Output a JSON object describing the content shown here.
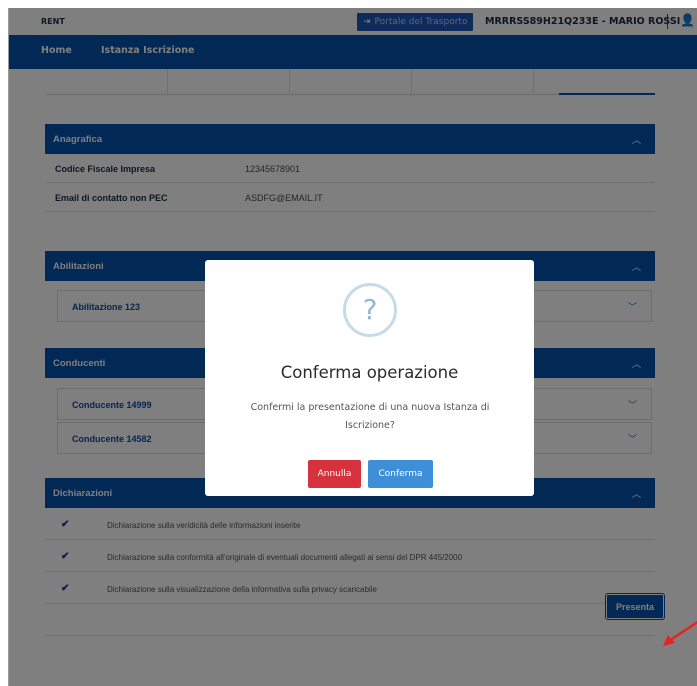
{
  "topbar": {
    "app_name": "RENT",
    "portal_button": "Portale del Trasporto",
    "user_info": "MRRRSS89H21Q233E - MARIO ROSSI"
  },
  "nav": {
    "home": "Home",
    "istanza": "Istanza Iscrizione"
  },
  "anagrafica": {
    "title": "Anagrafica",
    "rows": [
      {
        "label": "Codice Fiscale Impresa",
        "value": "12345678901"
      },
      {
        "label": "Email di contatto non PEC",
        "value": "ASDFG@EMAIL.IT"
      }
    ]
  },
  "abilitazioni": {
    "title": "Abilitazioni",
    "items": [
      "Abilitazione 123"
    ]
  },
  "conducenti": {
    "title": "Conducenti",
    "items": [
      "Conducente 14999",
      "Conducente 14582"
    ]
  },
  "dichiarazioni": {
    "title": "Dichiarazioni",
    "items": [
      "Dichiarazione sulla veridicità delle informazioni inserite",
      "Dichiarazione sulla conformità all'originale di eventuali documenti allegati ai sensi del DPR 445/2000",
      "Dichiarazione sulla visualizzazione della informativa sulla privacy scaricabile"
    ]
  },
  "presenta_button": "Presenta",
  "modal": {
    "icon_glyph": "?",
    "title": "Conferma operazione",
    "body": "Confermi la presentazione di una nuova Istanza di Iscrizione?",
    "cancel_label": "Annulla",
    "confirm_label": "Conferma"
  },
  "colors": {
    "primary": "#0450ad",
    "danger": "#d6323e",
    "confirm": "#3f8fd8",
    "annotation_arrow": "#e8231f"
  }
}
